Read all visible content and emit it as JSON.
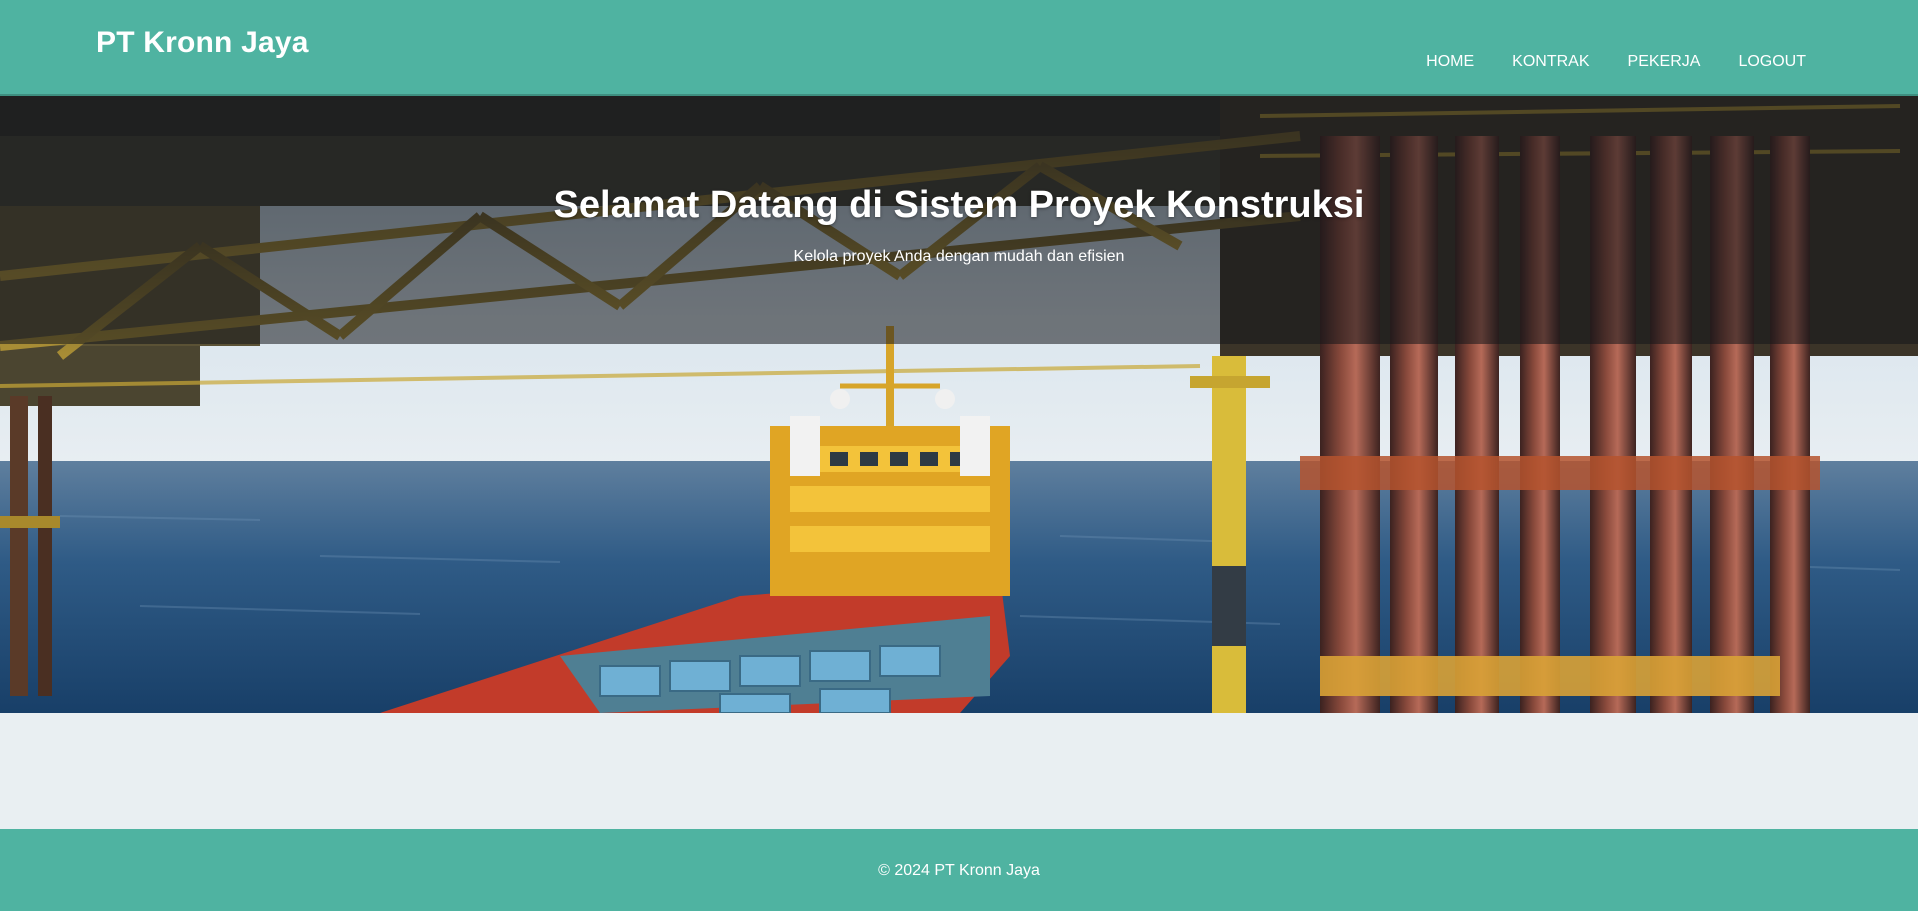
{
  "header": {
    "brand": "PT Kronn Jaya",
    "nav": [
      {
        "label": "HOME"
      },
      {
        "label": "KONTRAK"
      },
      {
        "label": "PEKERJA"
      },
      {
        "label": "LOGOUT"
      }
    ]
  },
  "hero": {
    "title": "Selamat Datang di Sistem Proyek Konstruksi",
    "subtitle": "Kelola proyek Anda dengan mudah dan efisien"
  },
  "footer": {
    "copyright": "© 2024 PT Kronn Jaya"
  },
  "colors": {
    "accent": "#4fb3a1",
    "page_background": "#e9eff2"
  }
}
